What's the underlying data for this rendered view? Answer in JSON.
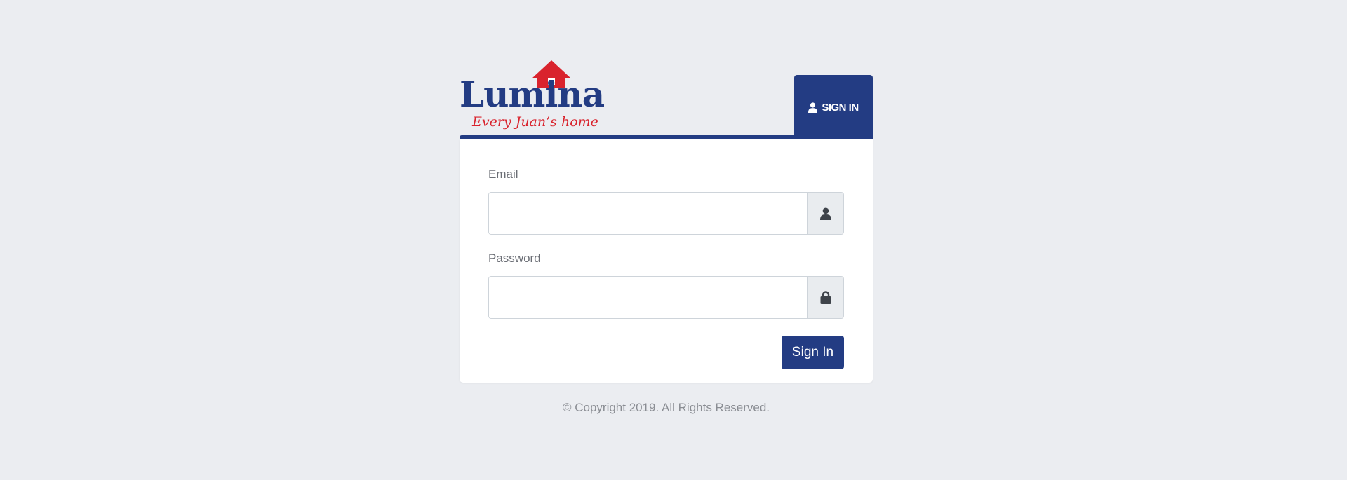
{
  "brand": {
    "name": "Lumina",
    "tagline": "Every Juan’s home",
    "primary_color": "#233c83",
    "accent_color": "#d9232d"
  },
  "header": {
    "tab_label": "SIGN IN",
    "tab_icon": "user-icon"
  },
  "form": {
    "email": {
      "label": "Email",
      "value": "",
      "placeholder": "",
      "icon": "user-icon"
    },
    "password": {
      "label": "Password",
      "value": "",
      "placeholder": "",
      "icon": "lock-icon"
    },
    "submit_label": "Sign In"
  },
  "footer": {
    "copyright": "© Copyright 2019. All Rights Reserved."
  }
}
